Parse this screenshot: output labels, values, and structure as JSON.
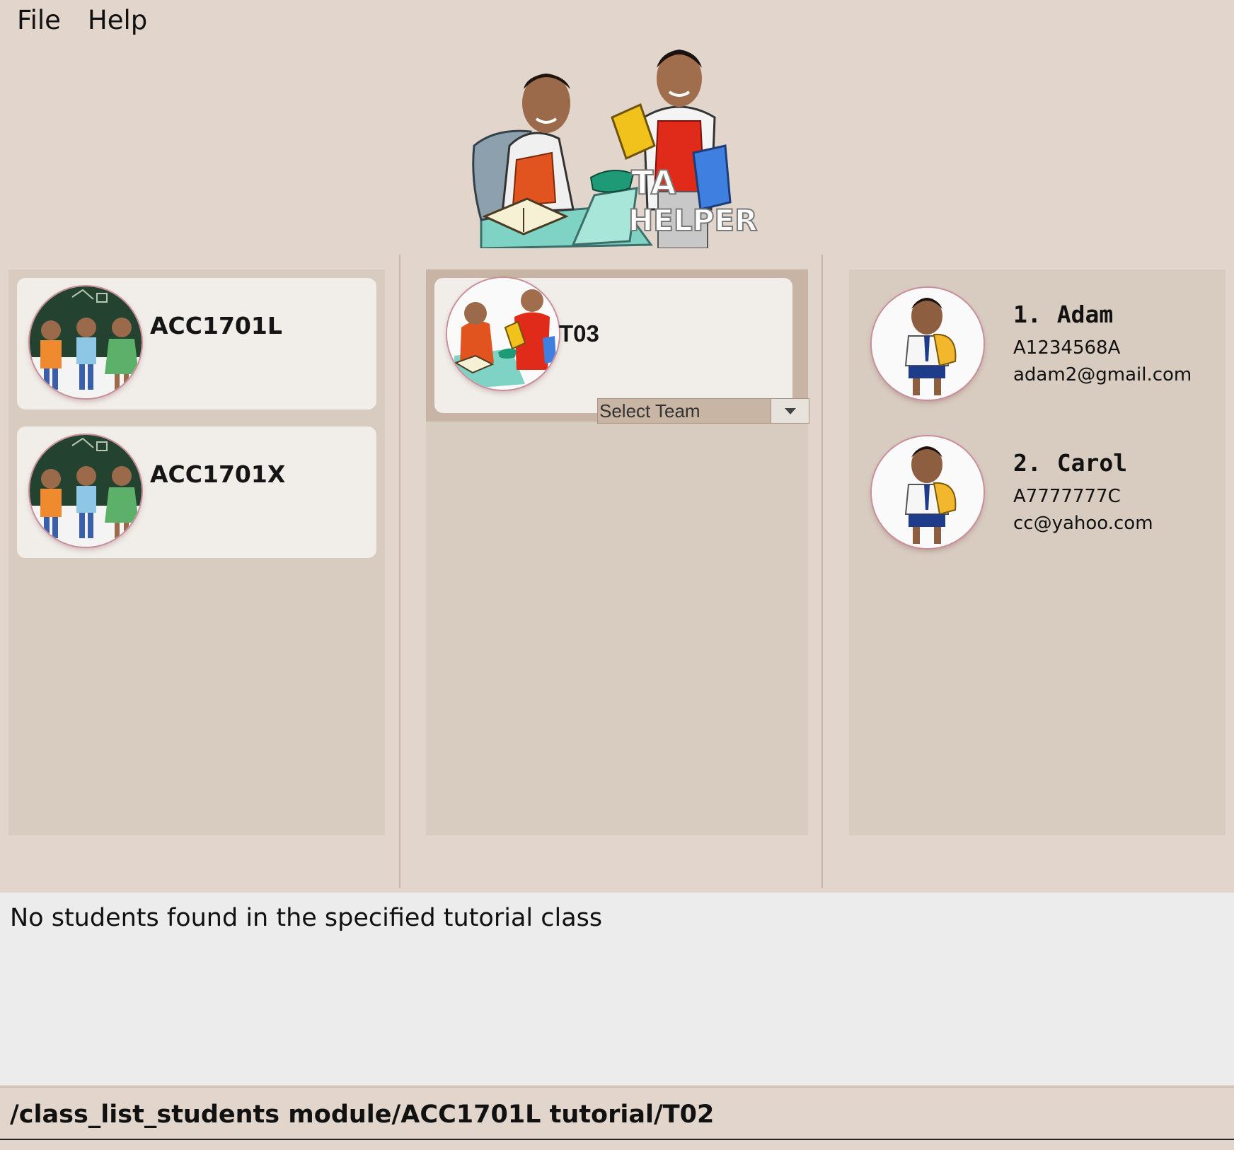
{
  "menu": {
    "items": [
      "File",
      "Help"
    ]
  },
  "banner": {
    "line1": "TA",
    "line2": "HELPER"
  },
  "modules": [
    {
      "code": "ACC1701L"
    },
    {
      "code": "ACC1701X"
    }
  ],
  "tutorials": [
    {
      "name": "T03",
      "select_label": "Select Team"
    }
  ],
  "students": [
    {
      "index": "1.",
      "name": "Adam",
      "id": "A1234568A",
      "email": "adam2@gmail.com"
    },
    {
      "index": "2.",
      "name": "Carol",
      "id": "A7777777C",
      "email": "cc@yahoo.com"
    }
  ],
  "result": {
    "message": "No students found in the specified tutorial class"
  },
  "command": {
    "value": "/class_list_students module/ACC1701L tutorial/T02"
  },
  "colors": {
    "background": "#e2d6cc",
    "panel": "#d8cbbf",
    "card": "#f1ede9",
    "selected": "#c8b4a4"
  }
}
